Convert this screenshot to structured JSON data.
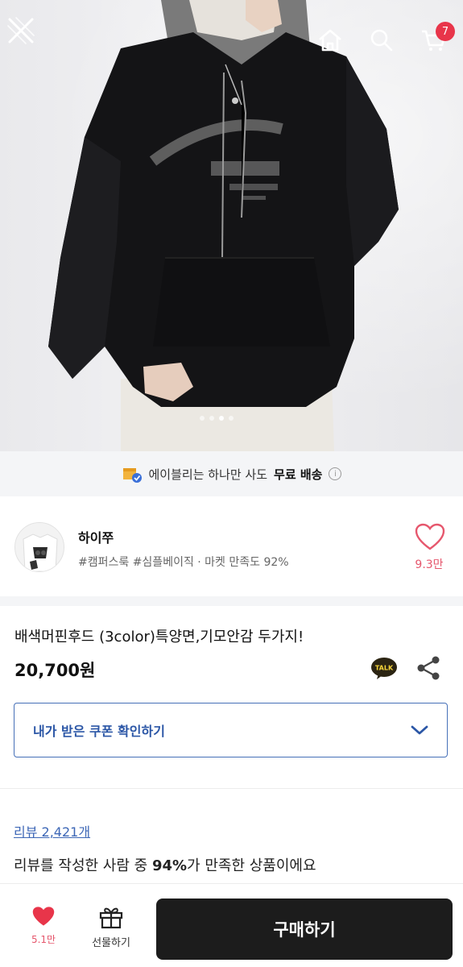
{
  "header": {
    "cart_count": "7",
    "icons": [
      "close-icon",
      "home-icon",
      "search-icon",
      "cart-icon"
    ]
  },
  "hero": {
    "carousel_dots": 4,
    "active_dot": 2
  },
  "shipping_banner": {
    "text_before": "에이블리는 하나만 사도",
    "text_bold": "무료 배송"
  },
  "shop": {
    "name": "하이쭈",
    "tags": "#캠퍼스룩 #심플베이직 · 마켓 만족도 92%",
    "like_count": "9.3만"
  },
  "product": {
    "title": "배색머핀후드 (3color)특양면,기모안감 두가지!",
    "price": "20,700원",
    "talk_label": "TALK",
    "coupon_label": "내가 받은 쿠폰 확인하기"
  },
  "reviews": {
    "link_label": "리뷰 2,421개",
    "summary_before": "리뷰를 작성한 사람 중",
    "summary_percent": "94%",
    "summary_after": "가 만족한 상품이에요"
  },
  "bottom_bar": {
    "wish_count": "5.1만",
    "gift_label": "선물하기",
    "buy_label": "구매하기"
  },
  "colors": {
    "accent_red": "#e6576d",
    "badge_red": "#e8354a",
    "coupon_blue": "#2b56a6",
    "buy_button": "#1c1c1c"
  }
}
